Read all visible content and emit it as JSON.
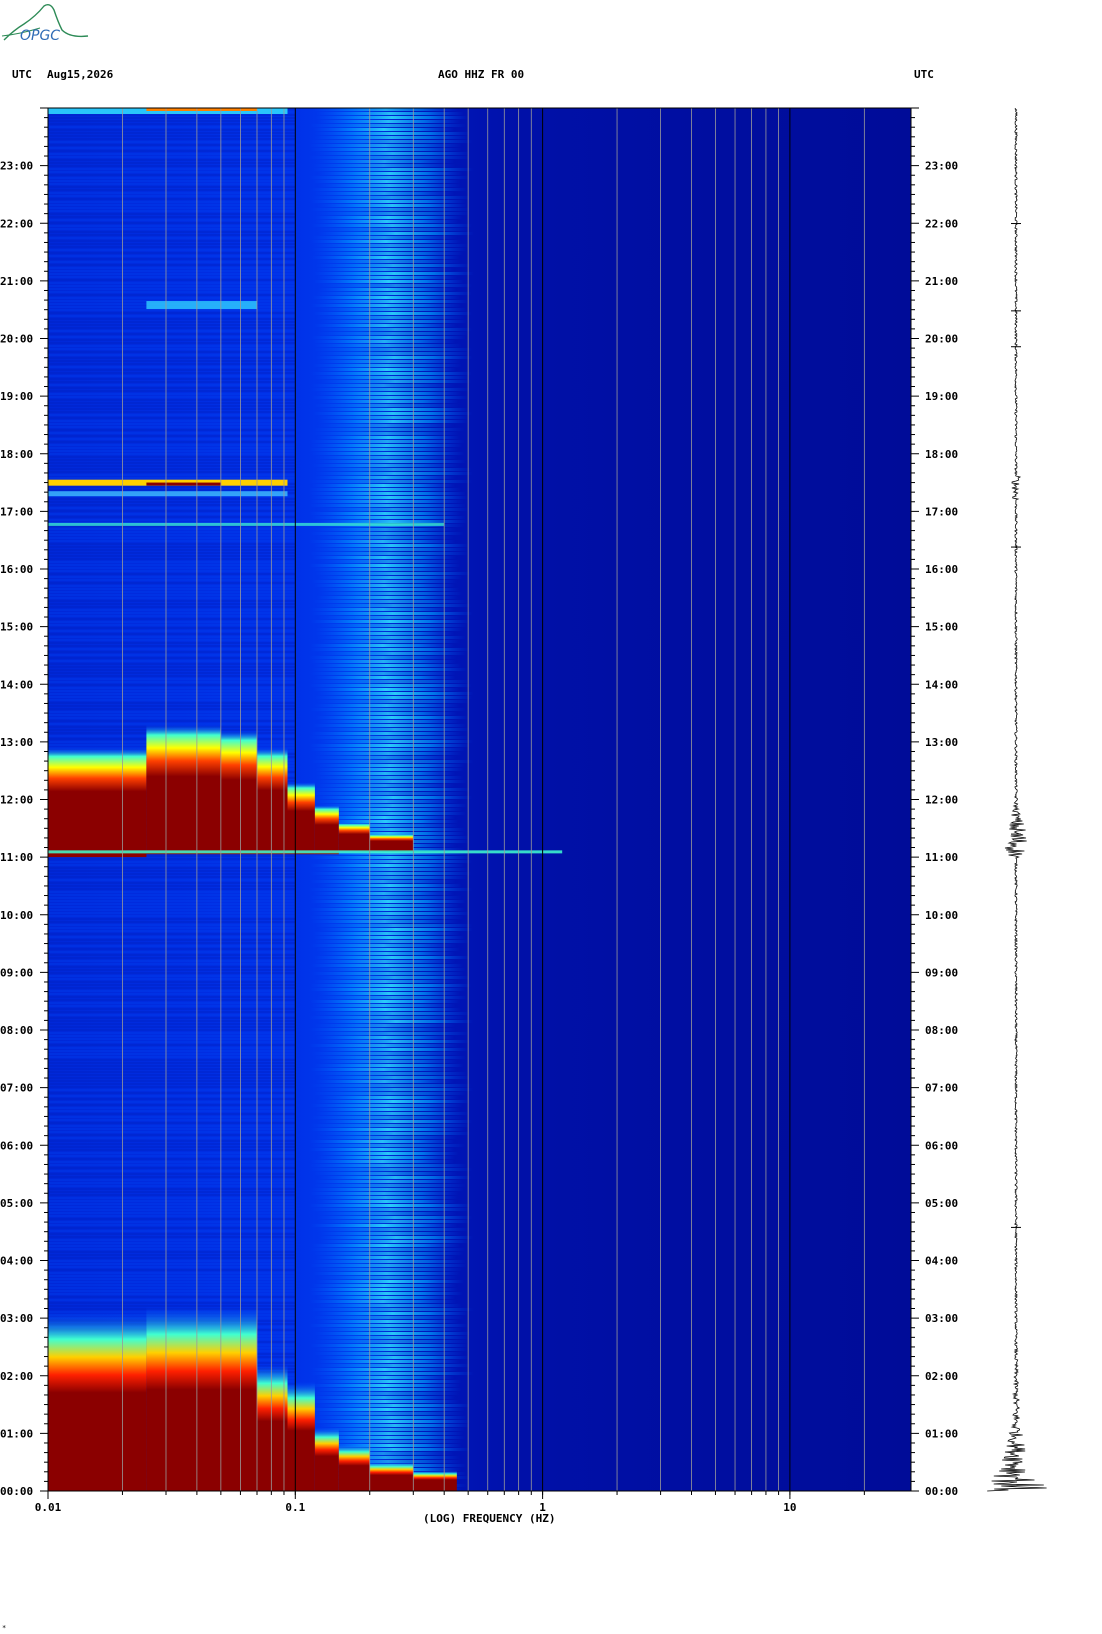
{
  "header": {
    "left_tz": "UTC",
    "date": "Aug15,2026",
    "station": "AGO HHZ FR 00",
    "right_tz": "UTC"
  },
  "logo": {
    "text": "OPGC",
    "color": "#2e8b57"
  },
  "credit": "*",
  "chart_data": {
    "type": "heatmap",
    "title": "AGO HHZ FR 00",
    "xlabel": "(LOG) FREQUENCY (HZ)",
    "x_scale": "log",
    "xlim": [
      0.01,
      30
    ],
    "x_tick_labels": [
      {
        "value": 0.01,
        "label": "0.01"
      },
      {
        "value": 0.1,
        "label": "0.1"
      },
      {
        "value": 1,
        "label": "1"
      },
      {
        "value": 10,
        "label": "10"
      }
    ],
    "x_gridlines_hz": [
      0.02,
      0.03,
      0.04,
      0.05,
      0.06,
      0.07,
      0.08,
      0.09,
      0.1,
      0.2,
      0.3,
      0.4,
      0.5,
      0.6,
      0.7,
      0.8,
      0.9,
      1,
      2,
      3,
      4,
      5,
      6,
      7,
      8,
      9,
      10,
      20
    ],
    "ylabel": "UTC",
    "ylim_hours": [
      0,
      24
    ],
    "y_tick_labels": [
      "00:00",
      "01:00",
      "02:00",
      "03:00",
      "04:00",
      "05:00",
      "06:00",
      "07:00",
      "08:00",
      "09:00",
      "10:00",
      "11:00",
      "12:00",
      "13:00",
      "14:00",
      "15:00",
      "16:00",
      "17:00",
      "18:00",
      "19:00",
      "20:00",
      "21:00",
      "22:00",
      "23:00"
    ],
    "colormap": [
      "#00008b",
      "#0020c8",
      "#0050ff",
      "#00c0ff",
      "#40ffd0",
      "#ffff00",
      "#ff8000",
      "#ff0000",
      "#8b0000"
    ],
    "events": [
      {
        "time_hours": 0.3,
        "label": "large event decaying 00:00-03:00"
      },
      {
        "time_hours": 11.1,
        "label": "event 11:05-12:30"
      },
      {
        "time_hours": 17.4,
        "label": "event 17:25"
      }
    ],
    "microseism_band_hz": [
      0.15,
      0.4
    ],
    "seismogram_trace": "right margin"
  }
}
